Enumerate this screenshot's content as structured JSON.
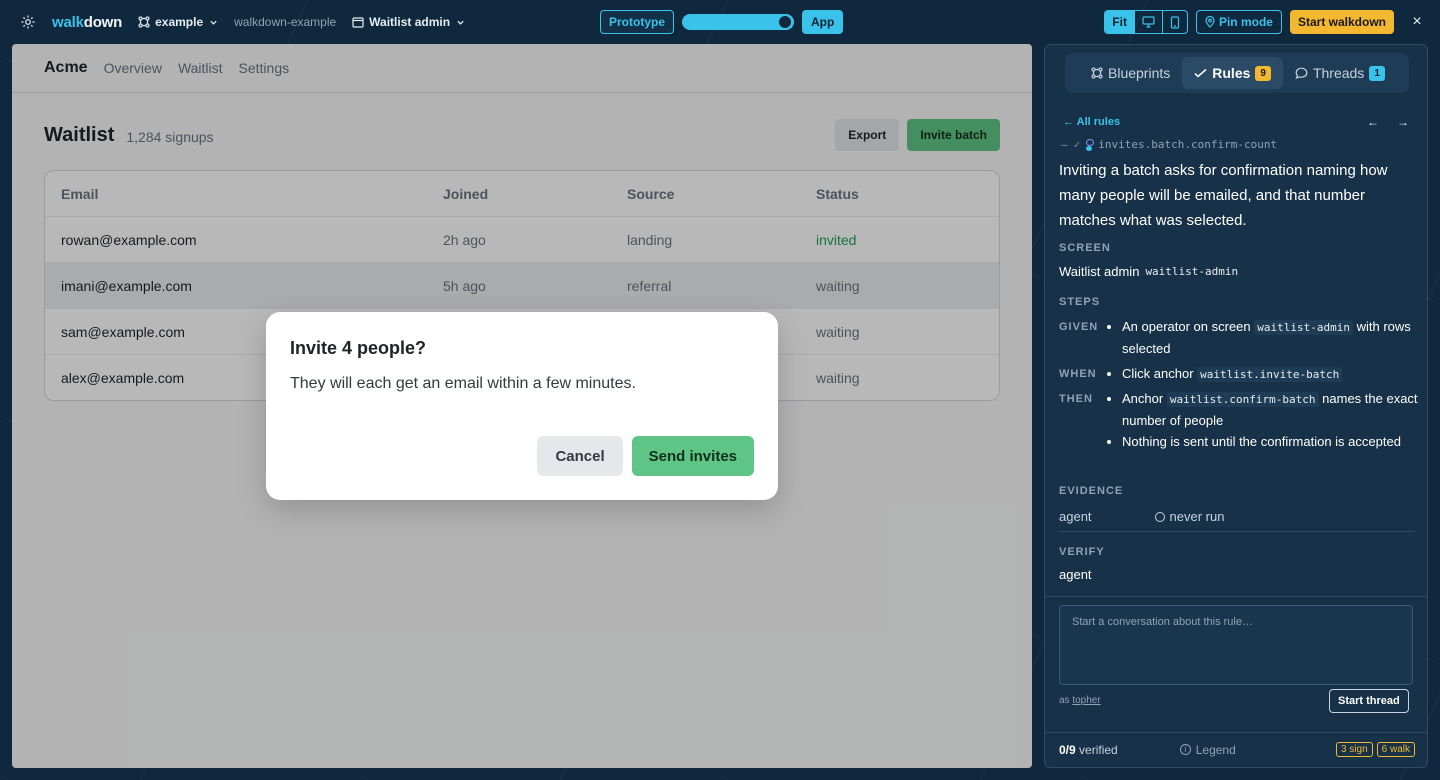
{
  "topbar": {
    "brand_prefix": "walk",
    "brand_suffix": "down",
    "project": "example",
    "repo": "walkdown-example",
    "screen": "Waitlist admin",
    "mode_prototype": "Prototype",
    "mode_app": "App",
    "fit": "Fit",
    "pin_mode": "Pin mode",
    "start_walkdown": "Start walkdown",
    "close": "×"
  },
  "app": {
    "logo": "Acme",
    "nav": [
      "Overview",
      "Waitlist",
      "Settings"
    ],
    "title": "Waitlist",
    "subtitle": "1,284 signups",
    "export": "Export",
    "invite_batch": "Invite batch",
    "table": {
      "headers": [
        "Email",
        "Joined",
        "Source",
        "Status"
      ],
      "rows": [
        [
          "rowan@example.com",
          "2h ago",
          "landing",
          "invited"
        ],
        [
          "imani@example.com",
          "5h ago",
          "referral",
          "waiting"
        ],
        [
          "sam@example.com",
          "",
          "",
          "waiting"
        ],
        [
          "alex@example.com",
          "",
          "",
          "waiting"
        ]
      ]
    },
    "modal": {
      "title": "Invite 4 people?",
      "body": "They will each get an email within a few minutes.",
      "cancel": "Cancel",
      "send": "Send invites"
    }
  },
  "panel": {
    "tabs": [
      {
        "label": "Blueprints",
        "badge": ""
      },
      {
        "label": "Rules",
        "badge": "9"
      },
      {
        "label": "Threads",
        "badge": "1"
      }
    ],
    "all_rules": "All rules",
    "rule_id": "invites.batch.confirm-count",
    "rule_text": "Inviting a batch asks for confirmation naming how many people will be emailed, and that number matches what was selected.",
    "labels": {
      "screen": "SCREEN",
      "steps": "STEPS",
      "evidence": "EVIDENCE",
      "verify": "VERIFY",
      "given": "GIVEN",
      "when": "WHEN",
      "then": "THEN"
    },
    "screen_name": "Waitlist admin",
    "screen_id": "waitlist-admin",
    "given": {
      "pre": "An operator on screen",
      "code": "waitlist-admin",
      "post": "with rows selected"
    },
    "when": {
      "pre": "Click anchor",
      "code": "waitlist.invite-batch"
    },
    "then": [
      {
        "pre": "Anchor",
        "code": "waitlist.confirm-batch",
        "post": "names the exact number of people"
      },
      {
        "text": "Nothing is sent until the confirmation is accepted"
      }
    ],
    "evidence_agent": "agent",
    "evidence_status": "never run",
    "verify_value": "agent",
    "thread_placeholder": "Start a conversation about this rule…",
    "as_prefix": "as",
    "as_user": "topher",
    "start_thread": "Start thread",
    "verified_count": "0/9",
    "verified_label": "verified",
    "legend": "Legend",
    "chip_sign": "3 sign",
    "chip_walk": "6 walk"
  },
  "colors": {
    "accent": "#39c3ea",
    "warning": "#f3b730",
    "success": "#5fc586",
    "panel_bg": "#173149"
  },
  "icons": [
    "gear-icon",
    "blueprint-icon",
    "chevron-down-icon",
    "window-icon",
    "desktop-icon",
    "mobile-icon",
    "pin-icon",
    "check-icon",
    "chat-icon",
    "arrow-left-icon",
    "arrow-right-icon",
    "info-icon"
  ]
}
